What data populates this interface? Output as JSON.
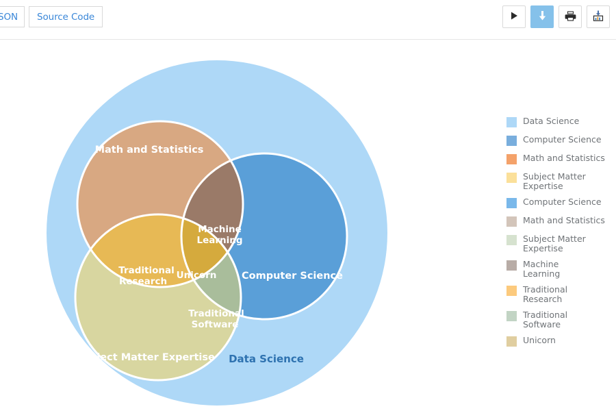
{
  "toolbar": {
    "tabs": [
      {
        "label": "SON",
        "name": "tab-json",
        "clipped": true
      },
      {
        "label": "Source Code",
        "name": "tab-source-code",
        "clipped": false
      }
    ],
    "buttons": [
      {
        "icon": "play-icon",
        "name": "run-button",
        "active": false
      },
      {
        "icon": "download-arrow-icon",
        "name": "download-button",
        "active": true
      },
      {
        "icon": "printer-icon",
        "name": "print-button",
        "active": false
      },
      {
        "icon": "export-chart-icon",
        "name": "export-chart-button",
        "active": false
      }
    ]
  },
  "chart_data": {
    "type": "venn",
    "title": "",
    "sets": [
      {
        "id": "data_science",
        "label": "Data Science",
        "color": "#aed8f7",
        "kind": "universe"
      },
      {
        "id": "math_stats",
        "label": "Math and Statistics",
        "color": "#d8a882",
        "kind": "set"
      },
      {
        "id": "computer_science",
        "label": "Computer Science",
        "color": "#5a9fd8",
        "kind": "set"
      },
      {
        "id": "subject_matter",
        "label": "Subject Matter Expertise",
        "color": "#d8d6a0",
        "kind": "set"
      }
    ],
    "intersections": [
      {
        "id": "machine_learning",
        "label": "Machine Learning",
        "members": [
          "math_stats",
          "computer_science"
        ],
        "color": "#9a7a68"
      },
      {
        "id": "traditional_research",
        "label": "Traditional Research",
        "members": [
          "math_stats",
          "subject_matter"
        ],
        "color": "#e7b955"
      },
      {
        "id": "traditional_software",
        "label": "Traditional Software",
        "members": [
          "computer_science",
          "subject_matter"
        ],
        "color": "#a9bd9b"
      },
      {
        "id": "unicorn",
        "label": "Unicorn",
        "members": [
          "math_stats",
          "computer_science",
          "subject_matter"
        ],
        "color": "#d5aa3d"
      }
    ],
    "labels": {
      "data_science": "Data Science",
      "math_stats": "Math and Statistics",
      "computer_science": "Computer Science",
      "subject_matter": "Subject Matter Expertise",
      "machine_learning": "Machine\nLearning",
      "traditional_research": "Traditional\nResearch",
      "traditional_software": "Traditional\nSoftware",
      "unicorn": "Unicorn"
    },
    "label_colors": {
      "data_science": "#2e72b0",
      "inner": "#ffffff"
    }
  },
  "legend": {
    "position": "right",
    "items": [
      {
        "label": "Data Science",
        "color": "#aed8f7"
      },
      {
        "label": "Computer Science",
        "color": "#79aedd"
      },
      {
        "label": "Math and Statistics",
        "color": "#f4a26a"
      },
      {
        "label": "Subject Matter Expertise",
        "color": "#fbe09a"
      },
      {
        "label": "Computer Science",
        "color": "#7ab8ea"
      },
      {
        "label": "Math and Statistics",
        "color": "#d3c5ba"
      },
      {
        "label": "Subject Matter Expertise",
        "color": "#d6e2cf"
      },
      {
        "label": "Machine\nLearning",
        "color": "#b8aca6"
      },
      {
        "label": "Traditional\nResearch",
        "color": "#fcca7d"
      },
      {
        "label": "Traditional\nSoftware",
        "color": "#c2d4c4"
      },
      {
        "label": "Unicorn",
        "color": "#e0cea0"
      }
    ]
  }
}
